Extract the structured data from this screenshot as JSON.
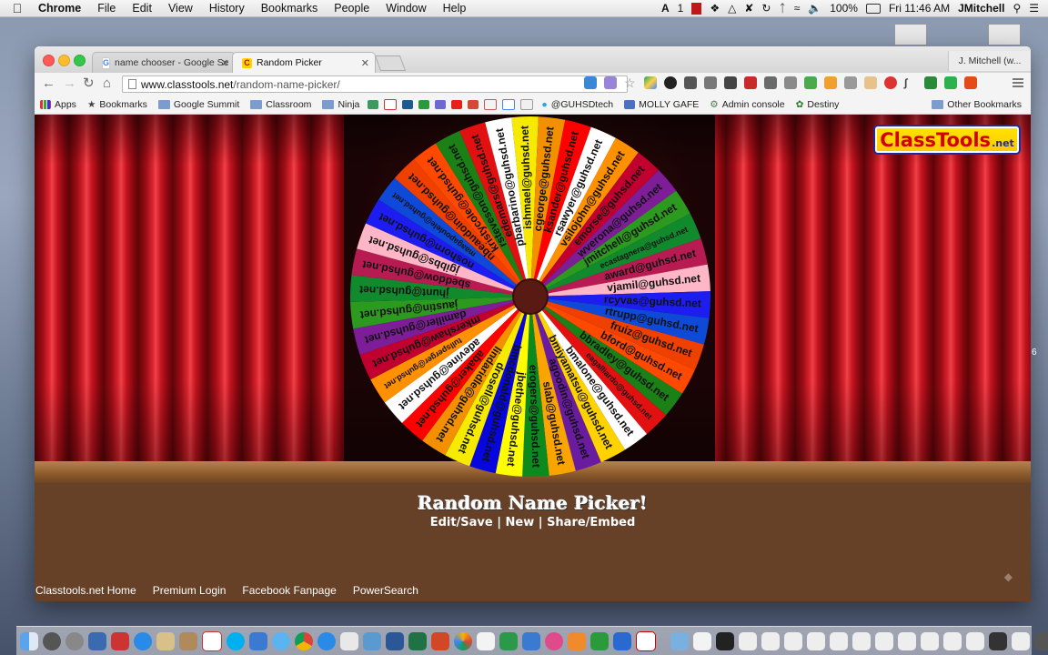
{
  "menubar": {
    "app": "Chrome",
    "items": [
      "File",
      "Edit",
      "View",
      "History",
      "Bookmarks",
      "People",
      "Window",
      "Help"
    ],
    "status": {
      "input_indicator": "1",
      "battery": "100%",
      "clock": "Fri 11:46 AM",
      "user": "JMitchell"
    }
  },
  "browser": {
    "tabs": [
      {
        "title": "name chooser - Google Se",
        "favicon": "google-icon",
        "active": false
      },
      {
        "title": "Random Picker",
        "favicon": "classtools-icon",
        "active": true
      }
    ],
    "profile": "J. Mitchell (w...",
    "address": {
      "host": "www.classtools.net",
      "path": "/random-name-picker/"
    },
    "bookmarks": [
      {
        "label": "Apps",
        "icon": "apps-grid-icon"
      },
      {
        "label": "Bookmarks",
        "icon": "star-icon"
      },
      {
        "label": "Google Summit",
        "icon": "folder-icon"
      },
      {
        "label": "Classroom",
        "icon": "folder-icon"
      },
      {
        "label": "Ninja",
        "icon": "folder-icon"
      },
      {
        "label": "@GUHSDtech",
        "icon": "twitter-icon"
      },
      {
        "label": "MOLLY GAFE",
        "icon": "doc-icon"
      },
      {
        "label": "Admin console",
        "icon": "gear-icon"
      },
      {
        "label": "Destiny",
        "icon": "destiny-icon"
      }
    ],
    "other_bookmarks": "Other Bookmarks"
  },
  "page": {
    "logo": {
      "main": "ClassTools",
      "suffix": ".net"
    },
    "title": "Random Name Picker!",
    "links": [
      "Edit/Save",
      "New",
      "Share/Embed"
    ],
    "link_separator": "|",
    "wheel": {
      "colors": [
        "#f6eb00",
        "#f29000",
        "#ff0000",
        "#ffffff",
        "#ff9000",
        "#c2002f",
        "#7d1e98",
        "#2c9a1f",
        "#118a2e",
        "#b81b52",
        "#ffb7c8",
        "#1d1df0",
        "#0e49d8",
        "#f04000",
        "#ff4900",
        "#1b8016",
        "#e21010",
        "#ffffff",
        "#ffd200",
        "#6a1ca0",
        "#f9a400",
        "#0c8a1e",
        "#fffd00",
        "#0606dd"
      ],
      "names": [
        "ishmael@guhsd.net",
        "cgeorge@guhsd.net",
        "ksander@guhsd.net",
        "rsawyer@guhsd.net",
        "vsilojohn@guhsd.net",
        "emorse@guhsd.net",
        "wverona@guhsd.net",
        "jmitchell@guhsd.net",
        "ecastagnera@guhsd.net",
        "award@guhsd.net",
        "vjamil@guhsd.net",
        "rcyvas@guhsd.net",
        "rtrupp@guhsd.net",
        "fruiz@guhsd.net",
        "bford@guhsd.net",
        "bbradley@guhsd.net",
        "eagalliardo@guhsd.net",
        "bmalone@guhsd.net",
        "bmiyamatsu@guhsd.net",
        "agoodin@guhsd.net",
        "slab@guhsd.net",
        "erogers@guhsd.net",
        "jbethe@guhsd.net",
        "bmcdonald@guhsd.net",
        "drosell@guhsd.net",
        "lindaridle@guhsd.net",
        "abaker@guhsd.net",
        "adevine@guhsd.net",
        "tullsperger@guhsd.net",
        "mkershaw@guhsd.net",
        "damiller@guhsd.net",
        "jaustin@guhsd.net",
        "jhunt@guhsd.net",
        "sbeddow@guhsd.net",
        "jgibbs@guhsd.net",
        "noshorn@guhsd.net",
        "maagapoulele@guhsd.net",
        "nbeaudoin@guhsd.net",
        "kristycole@guhsd.net",
        "rsteveson@guhsd.net",
        "edemars@guhsd.net",
        "pbarbarino@guhsd.net"
      ]
    }
  },
  "footer_links": [
    "Classtools.net Home",
    "Premium Login",
    "Facebook Fanpage",
    "PowerSearch"
  ],
  "side_digit": "6"
}
